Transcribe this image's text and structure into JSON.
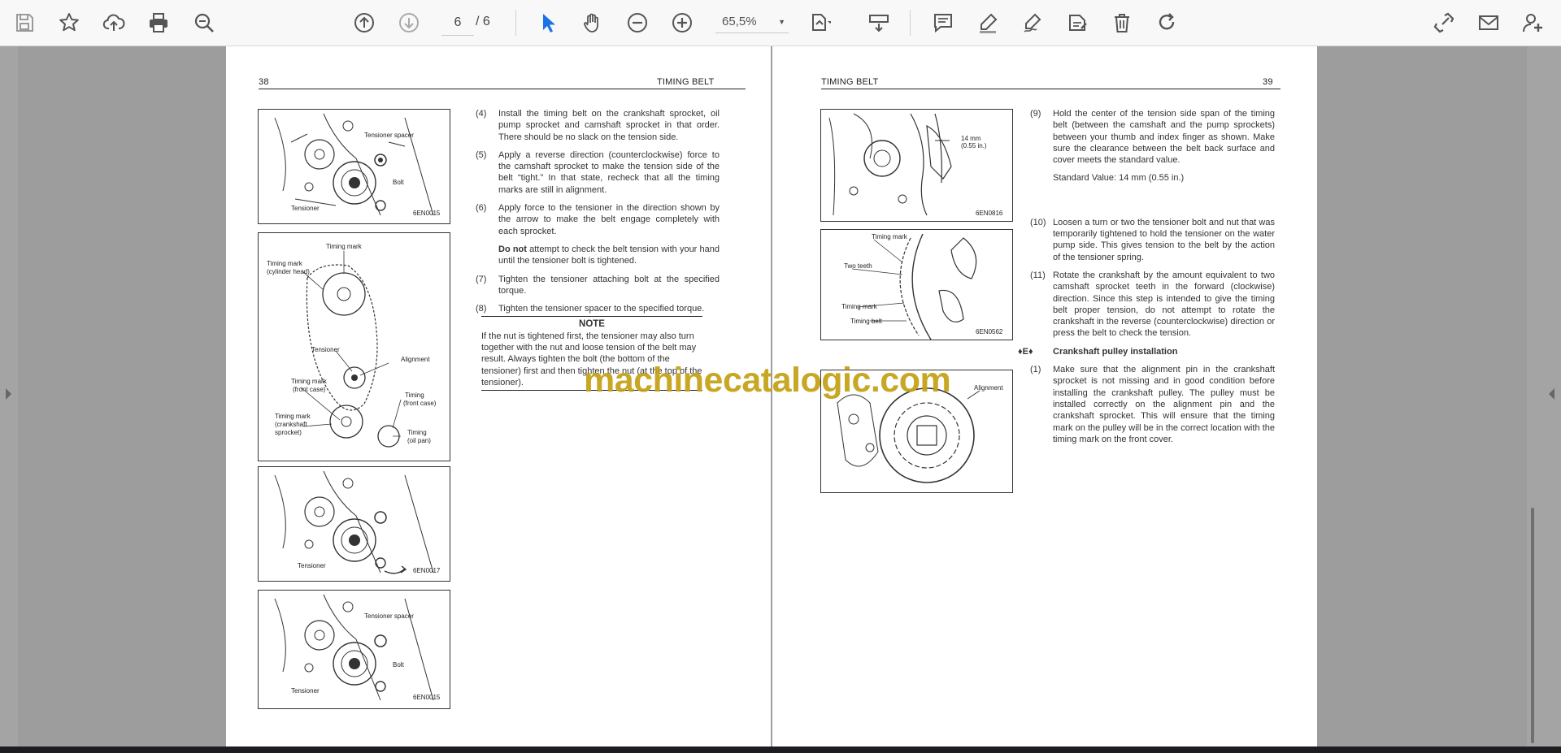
{
  "toolbar": {
    "page_current": "6",
    "page_total": "/ 6",
    "zoom": "65,5%",
    "icons": [
      "save-icon",
      "bookmark-star-icon",
      "upload-cloud-icon",
      "print-icon",
      "find-icon",
      "page-up-icon",
      "page-down-icon",
      "select-cursor-icon",
      "hand-pan-icon",
      "zoom-out-icon",
      "zoom-in-icon",
      "page-fit-icon",
      "scroll-mode-icon",
      "comment-icon",
      "highlight-pen-icon",
      "sign-icon",
      "stamp-icon",
      "delete-icon",
      "redo-icon",
      "share-link-icon",
      "email-icon",
      "add-user-icon"
    ]
  },
  "left_page": {
    "page_number": "38",
    "header_title": "TIMING BELT",
    "figures": [
      {
        "code": "6EN0015",
        "labels": [
          "Tensioner spacer",
          "Bolt",
          "Tensioner"
        ]
      },
      {
        "code": "",
        "labels": [
          "Timing mark",
          "Timing mark",
          "(cylinder head)",
          "Tensioner",
          "Alignment",
          "Timing mark",
          "(front case)",
          "Timing",
          "(front case)",
          "Timing mark",
          "(crankshaft",
          "sprocket)",
          "Timing",
          "(oil pan)"
        ]
      },
      {
        "code": "6EN0017",
        "labels": [
          "Tensioner"
        ]
      },
      {
        "code": "6EN0015",
        "labels": [
          "Tensioner spacer",
          "Bolt",
          "Tensioner"
        ]
      }
    ],
    "steps": [
      {
        "num": "(4)",
        "text": "Install the timing belt on the crankshaft sprocket, oil pump sprocket and camshaft sprocket in that order. There should be no slack on the tension side."
      },
      {
        "num": "(5)",
        "text": "Apply a reverse direction (counterclockwise) force to the camshaft sprocket to make the tension side of the belt “tight.” In that state, recheck that all the timing marks are still in alignment."
      },
      {
        "num": "(6)",
        "text": "Apply force to the tensioner in the direction shown by the arrow to make the belt engage completely with each sprocket."
      },
      {
        "num": "",
        "bold": "Do not",
        "text": " attempt to check the belt tension with your hand until the tensioner bolt is tightened."
      },
      {
        "num": "(7)",
        "text": "Tighten the tensioner attaching bolt at the specified torque."
      },
      {
        "num": "(8)",
        "text": "Tighten the tensioner spacer to the specified torque."
      }
    ],
    "note_title": "NOTE",
    "note_text": "If the nut is tightened first, the tensioner may also turn together with the nut and loose tension of the belt may result. Always tighten the bolt (the bottom of the tensioner) first and then tighten the nut (at the top of the tensioner)."
  },
  "right_page": {
    "page_number": "39",
    "header_title": "TIMING BELT",
    "figures": [
      {
        "code": "6EN0816",
        "labels": [
          "14 mm",
          "(0.55 in.)"
        ]
      },
      {
        "code": "6EN0562",
        "labels": [
          "Timing mark",
          "Two teeth",
          "Timing mark",
          "Timing belt"
        ]
      },
      {
        "code": "",
        "labels": [
          "Alignment"
        ]
      }
    ],
    "steps": [
      {
        "num": "(9)",
        "text": "Hold the center of the tension side span of the timing belt (between the camshaft and the pump sprockets) between your thumb and index finger as shown. Make sure the clearance between the belt back surface and cover meets the standard value."
      },
      {
        "num": "",
        "text": "Standard Value:    14 mm (0.55 in.)"
      },
      {
        "num": "(10)",
        "text": "Loosen a turn or two the tensioner bolt and nut that was temporarily tightened to hold the tensioner on the water pump side. This gives tension to the belt by the action of the tensioner spring."
      },
      {
        "num": "(11)",
        "text": "Rotate the crankshaft by the amount equivalent to two camshaft sprocket teeth in the forward (clockwise) direction. Since this step is intended to give the timing belt proper tension, do not attempt to rotate the crankshaft in the reverse (counterclockwise) direction or press the belt to check the tension."
      }
    ],
    "section_marker": "♦E♦",
    "section_title": "Crankshaft pulley installation",
    "section_steps": [
      {
        "num": "(1)",
        "text": "Make sure that the alignment pin in the crankshaft sprocket is not missing and in good condition before installing the crankshaft pulley. The pulley must be installed correctly on the alignment pin and the crankshaft sprocket. This will ensure that the timing mark on the pulley will be in the correct location with the timing mark on the front cover."
      }
    ]
  },
  "watermark": "machinecatalogic.com"
}
